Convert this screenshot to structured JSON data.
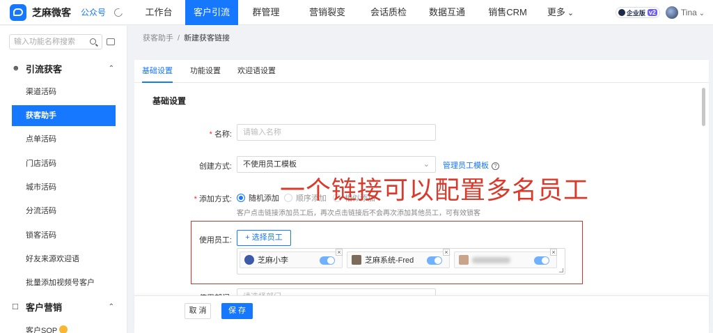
{
  "app": {
    "name": "芝麻微客",
    "account_type": "公众号"
  },
  "top_nav": [
    {
      "label": "工作台",
      "active": false
    },
    {
      "label": "客户引流",
      "active": true
    },
    {
      "label": "群管理",
      "active": false
    },
    {
      "label": "营销裂变",
      "active": false
    },
    {
      "label": "会话质检",
      "active": false
    },
    {
      "label": "数据互通",
      "active": false
    },
    {
      "label": "销售CRM",
      "active": false
    },
    {
      "label": "更多",
      "active": false
    }
  ],
  "user": {
    "edition": "企业版",
    "version": "v2",
    "name": "Tina"
  },
  "sidebar": {
    "search_placeholder": "输入功能名称搜索",
    "groups": [
      {
        "title": "引流获客",
        "items": [
          "渠道活码",
          "获客助手",
          "点单活码",
          "门店活码",
          "城市活码",
          "分流活码",
          "锁客活码",
          "好友来源欢迎语",
          "批量添加视频号客户"
        ],
        "active_item": "获客助手"
      },
      {
        "title": "客户营销",
        "items": [
          "客户SOP"
        ]
      }
    ]
  },
  "breadcrumb": {
    "parent": "获客助手",
    "separator": "/",
    "current": "新建获客链接"
  },
  "tabs": [
    {
      "label": "基础设置",
      "active": true
    },
    {
      "label": "功能设置",
      "active": false
    },
    {
      "label": "欢迎语设置",
      "active": false
    }
  ],
  "form": {
    "section_title": "基础设置",
    "name": {
      "label": "名称:",
      "placeholder": "请输入名称"
    },
    "create_mode": {
      "label": "创建方式:",
      "value": "不使用员工模板",
      "manage_link": "管理员工模板",
      "help": "?"
    },
    "add_mode": {
      "label": "添加方式:",
      "options": [
        "随机添加",
        "顺序添加",
        "相似添加"
      ],
      "selected": "随机添加",
      "hint": "客户点击链接添加员工后，再次点击链接后不会再次添加其他员工，可有效锁客"
    },
    "employees": {
      "label": "使用员工:",
      "select_button": "选择员工",
      "list": [
        {
          "name": "芝麻小李",
          "enabled": true
        },
        {
          "name": "芝麻系统-Fred",
          "enabled": true
        },
        {
          "name": "",
          "enabled": true
        }
      ]
    },
    "department": {
      "label": "使用部门:",
      "placeholder": "请选择部门"
    }
  },
  "annotation": "一个链接可以配置多名员工",
  "footer": {
    "cancel": "取 消",
    "save": "保 存"
  },
  "colors": {
    "primary": "#1677ff",
    "annotation": "#d93a2b"
  }
}
